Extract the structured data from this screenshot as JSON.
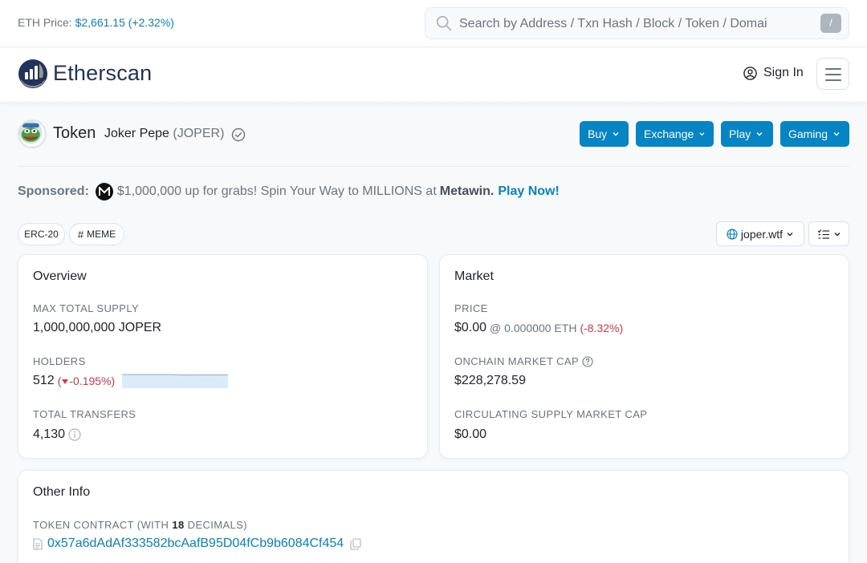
{
  "topbar": {
    "eth_price_label": "ETH Price:",
    "eth_price_value": "$2,661.15 (+2.32%)",
    "search_placeholder": "Search by Address / Txn Hash / Block / Token / Domai",
    "search_shortcut": "/"
  },
  "header": {
    "brand": "Etherscan",
    "sign_in": "Sign In"
  },
  "token": {
    "word": "Token",
    "name": "Joker Pepe",
    "symbol": "(JOPER)",
    "buttons": [
      "Buy",
      "Exchange",
      "Play",
      "Gaming"
    ]
  },
  "sponsored": {
    "label": "Sponsored:",
    "text": "$1,000,000 up for grabs! Spin Your Way to MILLIONS at",
    "brand": "Metawin.",
    "cta": "Play Now!"
  },
  "tags": [
    "ERC-20",
    "MEME"
  ],
  "website": "joper.wtf",
  "overview": {
    "title": "Overview",
    "max_supply_label": "MAX TOTAL SUPPLY",
    "max_supply_value": "1,000,000,000 JOPER",
    "holders_label": "HOLDERS",
    "holders_value": "512",
    "holders_change": "-0.195%)",
    "transfers_label": "TOTAL TRANSFERS",
    "transfers_value": "4,130"
  },
  "market": {
    "title": "Market",
    "price_label": "PRICE",
    "price_value": "$0.00",
    "price_eth": "@ 0.000000 ETH",
    "price_change": "(-8.32%)",
    "mcap_label": "ONCHAIN MARKET CAP",
    "mcap_value": "$228,278.59",
    "circ_label": "CIRCULATING SUPPLY MARKET CAP",
    "circ_value": "$0.00"
  },
  "other_info": {
    "title": "Other Info",
    "contract_label_prefix": "TOKEN CONTRACT (WITH",
    "decimals": "18",
    "contract_label_suffix": "DECIMALS)",
    "contract_address": "0x57a6dAdAf333582bcAafB95D04fCb9b6084Cf454"
  },
  "colors": {
    "accent": "#0784c3",
    "negative": "#dc3545",
    "brand": "#21325b"
  }
}
